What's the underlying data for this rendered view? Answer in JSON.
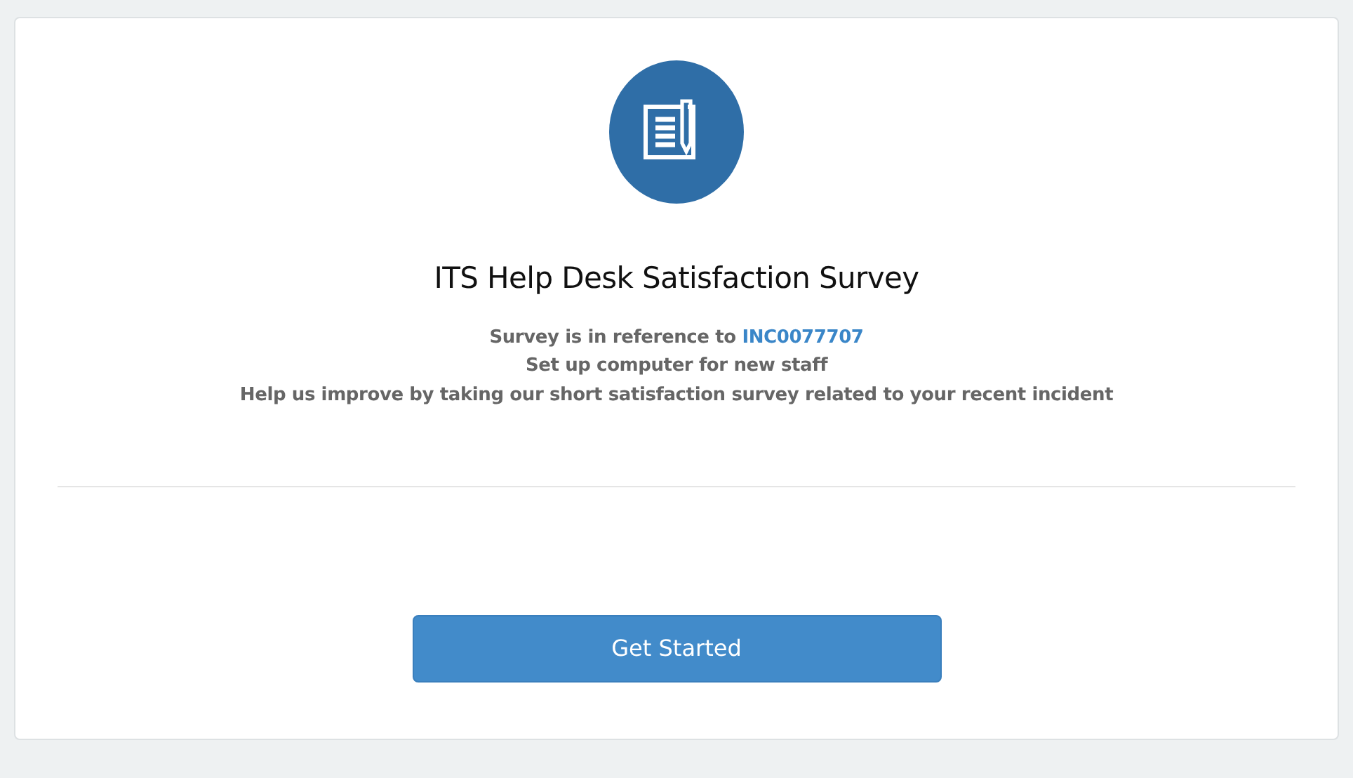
{
  "survey": {
    "title": "ITS Help Desk Satisfaction Survey",
    "reference": {
      "text": "Survey is in reference to ",
      "link": "INC0077707"
    },
    "lines": [
      "Set up computer for new staff",
      "Help us improve by taking our short satisfaction survey related to your recent incident"
    ],
    "button": "Get Started"
  }
}
